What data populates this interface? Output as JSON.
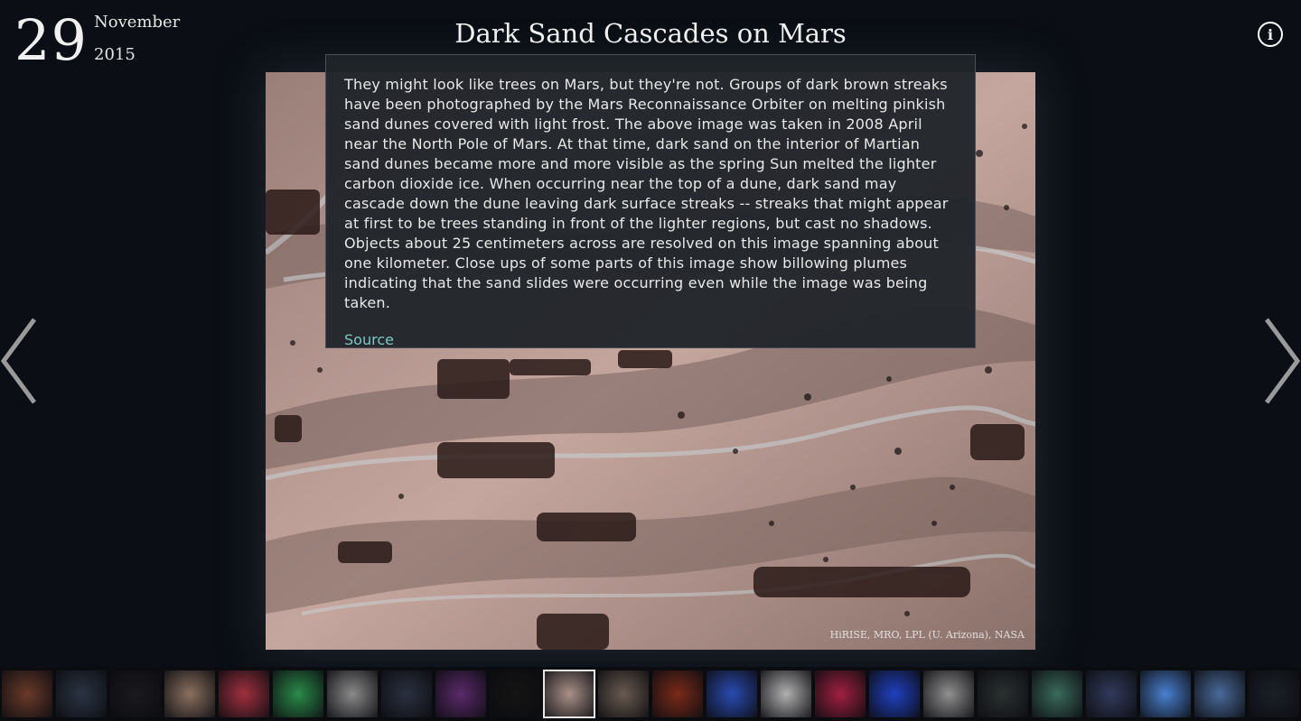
{
  "date": {
    "day": "29",
    "month": "November",
    "year": "2015"
  },
  "title": "Dark Sand Cascades on Mars",
  "image": {
    "credit": "HiRISE, MRO, LPL (U. Arizona), NASA"
  },
  "description": {
    "text": "They might look like trees on Mars, but they're not. Groups of dark brown streaks have been photographed by the Mars Reconnaissance Orbiter on melting pinkish sand dunes covered with light frost. The above image was taken in 2008 April near the North Pole of Mars. At that time, dark sand on the interior of Martian sand dunes became more and more visible as the spring Sun melted the lighter carbon dioxide ice. When occurring near the top of a dune, dark sand may cascade down the dune leaving dark surface streaks -- streaks that might appear at first to be trees standing in front of the lighter regions, but cast no shadows. Objects about 25 centimeters across are resolved on this image spanning about one kilometer. Close ups of some parts of this image show billowing plumes indicating that the sand slides were occurring even while the image was being taken.",
    "source_label": "Source"
  },
  "icons": {
    "info": "info-icon",
    "prev": "chevron-left-icon",
    "next": "chevron-right-icon"
  },
  "colors": {
    "background": "#0b0f15",
    "link": "#7fc6c6",
    "panel": "#20242a"
  },
  "filmstrip": {
    "selected_index": 10,
    "thumbnails": [
      {
        "name": "galaxy-jet",
        "color": "#6a3a2a"
      },
      {
        "name": "night-sky-horizon",
        "color": "#2a3444"
      },
      {
        "name": "star-field",
        "color": "#1a1a1e"
      },
      {
        "name": "phobos-moon",
        "color": "#8a7060"
      },
      {
        "name": "orion-nebula",
        "color": "#a03040"
      },
      {
        "name": "green-aurora",
        "color": "#2a8a4a"
      },
      {
        "name": "gray-surface",
        "color": "#8a8a8a"
      },
      {
        "name": "horizon-dusk",
        "color": "#2a3040"
      },
      {
        "name": "purple-nebula",
        "color": "#5a2a6a"
      },
      {
        "name": "dark-field",
        "color": "#141414"
      },
      {
        "name": "mars-sand-dunes",
        "color": "#a89088"
      },
      {
        "name": "spiral-galaxy",
        "color": "#6a5a50"
      },
      {
        "name": "red-nebula",
        "color": "#7a2a1a"
      },
      {
        "name": "blue-star-burst",
        "color": "#2a4ab0"
      },
      {
        "name": "light-streak",
        "color": "#b0b0b0"
      },
      {
        "name": "red-cluster",
        "color": "#a02040"
      },
      {
        "name": "blue-star-burst-2",
        "color": "#2040c0"
      },
      {
        "name": "gray-diagram",
        "color": "#909090"
      },
      {
        "name": "comet-trail",
        "color": "#2a3030"
      },
      {
        "name": "aurora-night",
        "color": "#3a6a5a"
      },
      {
        "name": "galaxy-pair",
        "color": "#303a5a"
      },
      {
        "name": "blue-square",
        "color": "#4a80d0"
      },
      {
        "name": "earth-limb",
        "color": "#4a6a9a"
      },
      {
        "name": "dark-sky-end",
        "color": "#1a2028"
      }
    ]
  }
}
